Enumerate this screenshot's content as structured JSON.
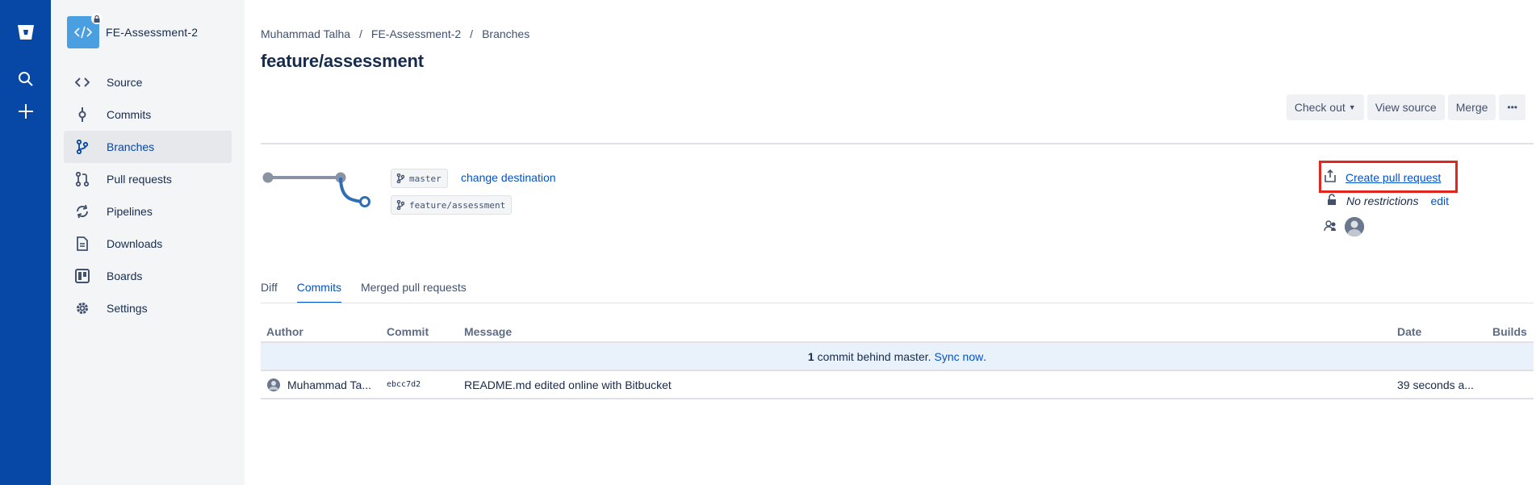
{
  "global_nav": {
    "items": [
      "bitbucket-logo",
      "search-icon",
      "create-icon"
    ]
  },
  "sidebar": {
    "repo_name": "FE-Assessment-2",
    "items": [
      {
        "label": "Source",
        "icon": "source-icon"
      },
      {
        "label": "Commits",
        "icon": "commits-icon"
      },
      {
        "label": "Branches",
        "icon": "branches-icon",
        "active": true
      },
      {
        "label": "Pull requests",
        "icon": "pull-requests-icon"
      },
      {
        "label": "Pipelines",
        "icon": "pipelines-icon"
      },
      {
        "label": "Downloads",
        "icon": "downloads-icon"
      },
      {
        "label": "Boards",
        "icon": "boards-icon"
      },
      {
        "label": "Settings",
        "icon": "settings-icon"
      }
    ]
  },
  "breadcrumb": {
    "user": "Muhammad Talha",
    "repo": "FE-Assessment-2",
    "section": "Branches",
    "separator": "/"
  },
  "page": {
    "title": "feature/assessment"
  },
  "actions": {
    "checkout": "Check out",
    "view_source": "View source",
    "merge": "Merge",
    "more": "•••"
  },
  "branch": {
    "destination": "master",
    "source": "feature/assessment",
    "change_destination": "change destination"
  },
  "panel": {
    "create_pr": "Create pull request",
    "restrictions": "No restrictions",
    "edit": "edit"
  },
  "tabs": [
    {
      "label": "Diff",
      "active": false
    },
    {
      "label": "Commits",
      "active": true
    },
    {
      "label": "Merged pull requests",
      "active": false
    }
  ],
  "table": {
    "headers": {
      "author": "Author",
      "commit": "Commit",
      "message": "Message",
      "date": "Date",
      "builds": "Builds"
    },
    "behind": {
      "count": "1",
      "text": "commit behind master.",
      "sync": "Sync now",
      "period": "."
    },
    "rows": [
      {
        "author": "Muhammad Ta...",
        "commit": "ebcc7d2",
        "message": "README.md edited online with Bitbucket",
        "date": "39 seconds a..."
      }
    ]
  },
  "colors": {
    "global_nav": "#0747a6",
    "link": "#0052cc",
    "highlight_box": "#e3261d"
  }
}
